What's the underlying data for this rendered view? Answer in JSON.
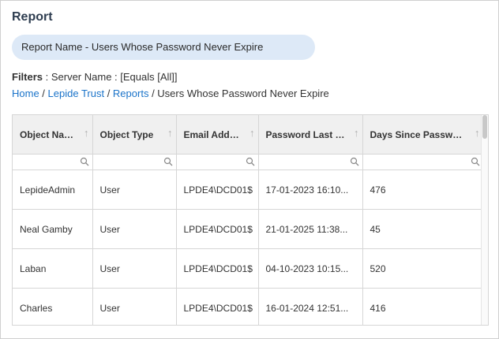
{
  "page": {
    "title": "Report"
  },
  "report": {
    "name_label": "Report Name - Users Whose Password Never Expire"
  },
  "filters": {
    "label": "Filters",
    "value": " : Server Name : [Equals [All]]"
  },
  "breadcrumb": {
    "items": [
      "Home",
      "Lepide Trust",
      "Reports"
    ],
    "current": "Users Whose Password Never Expire",
    "separator": " / "
  },
  "table": {
    "columns": [
      "Object Name",
      "Object  Type",
      "Email Address",
      "Password Last Set",
      "Days Since Password..."
    ],
    "rows": [
      [
        "LepideAdmin",
        "User",
        "LPDE4\\DCD01$",
        "17-01-2023 16:10...",
        "476"
      ],
      [
        "Neal Gamby",
        "User",
        "LPDE4\\DCD01$",
        "21-01-2025 11:38...",
        "45"
      ],
      [
        "Laban",
        "User",
        "LPDE4\\DCD01$",
        "04-10-2023 10:15...",
        "520"
      ],
      [
        "Charles",
        "User",
        "LPDE4\\DCD01$",
        "16-01-2024 12:51...",
        "416"
      ]
    ]
  },
  "icons": {
    "sort": "sort-up-arrow-icon",
    "filter": "search-icon"
  },
  "colors": {
    "accent": "#1a73c9",
    "pill": "#dde9f7",
    "header_bg": "#f0f0f0"
  }
}
